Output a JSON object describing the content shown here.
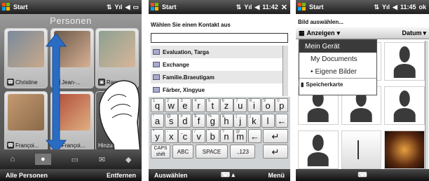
{
  "screen1": {
    "title": "Start",
    "header": "Personen",
    "contacts": [
      {
        "name": "Christine"
      },
      {
        "name": "Jean-..."
      },
      {
        "name": "Ragna"
      },
      {
        "name": "Françoi..."
      },
      {
        "name": "Françoi..."
      },
      {
        "name": "Hinzufügen"
      }
    ],
    "softkey_left": "Alle Personen",
    "softkey_right": "Entfernen"
  },
  "screen2": {
    "title": "Start",
    "time": "11:42",
    "close": "✕",
    "prompt": "Wählen Sie einen Kontakt aus",
    "search_value": "",
    "contacts": [
      {
        "name": "Evaluation, Targa"
      },
      {
        "name": "Exchange"
      },
      {
        "name": "Familie.Braeutigam"
      },
      {
        "name": "Färber, Xingyue"
      }
    ],
    "keys_row1": [
      "q",
      "w",
      "e",
      "r",
      "t",
      "z",
      "u",
      "i",
      "o",
      "p"
    ],
    "keys_row1_alt": [
      "1",
      "2",
      "3",
      "4",
      "5",
      "6",
      "7",
      "8",
      "9",
      "0"
    ],
    "keys_row2": [
      "a",
      "s",
      "d",
      "f",
      "g",
      "h",
      "j",
      "k",
      "l"
    ],
    "keys_row2_alt": [
      "!",
      "@",
      "#",
      "$",
      "%",
      "&",
      "(",
      ")",
      "'"
    ],
    "keys_row3": [
      "y",
      "x",
      "c",
      "v",
      "b",
      "n",
      "m"
    ],
    "keys_row3_alt": [
      "*",
      "-",
      "_",
      "/",
      "\"",
      "?",
      "@"
    ],
    "caps": "CAPS shift",
    "abc": "ABC",
    "space": "SPACE",
    "num": ".,123",
    "softkey_left": "Auswählen",
    "softkey_right": "Menü"
  },
  "screen3": {
    "title": "Start",
    "time": "11:45",
    "ok": "ok",
    "prompt": "Bild auswählen...",
    "toolbar_left": "Anzeigen",
    "toolbar_right": "Datum",
    "menu_items": [
      {
        "label": "Mein Gerät"
      },
      {
        "label": "My Documents"
      },
      {
        "label": "Eigene Bilder"
      },
      {
        "label": "Speicherkarte"
      }
    ]
  },
  "colors": {
    "titlebar": "#2a2a2a",
    "accent_blue": "#2a6cc4"
  }
}
